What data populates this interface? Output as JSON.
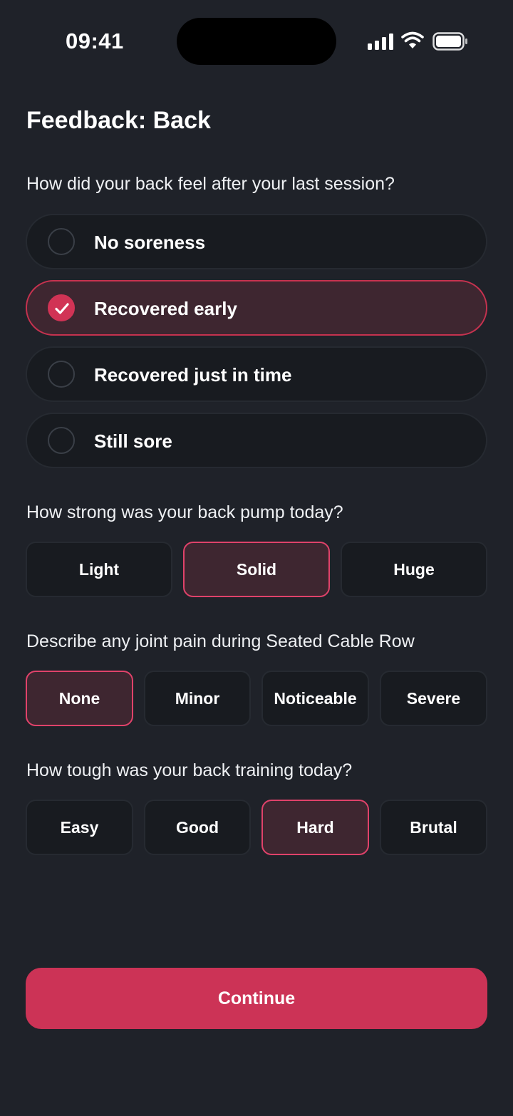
{
  "status_bar": {
    "time": "09:41"
  },
  "title": "Feedback: Back",
  "soreness": {
    "question": "How did your back feel after your last session?",
    "options": [
      {
        "label": "No soreness",
        "selected": false
      },
      {
        "label": "Recovered early",
        "selected": true
      },
      {
        "label": "Recovered just in time",
        "selected": false
      },
      {
        "label": "Still sore",
        "selected": false
      }
    ]
  },
  "pump": {
    "question": "How strong was your back pump today?",
    "options": [
      {
        "label": "Light",
        "selected": false
      },
      {
        "label": "Solid",
        "selected": true
      },
      {
        "label": "Huge",
        "selected": false
      }
    ]
  },
  "joint_pain": {
    "question": "Describe any joint pain during Seated Cable Row",
    "options": [
      {
        "label": "None",
        "selected": true
      },
      {
        "label": "Minor",
        "selected": false
      },
      {
        "label": "Noticeable",
        "selected": false
      },
      {
        "label": "Severe",
        "selected": false
      }
    ]
  },
  "difficulty": {
    "question": "How tough was your back training today?",
    "options": [
      {
        "label": "Easy",
        "selected": false
      },
      {
        "label": "Good",
        "selected": false
      },
      {
        "label": "Hard",
        "selected": true
      },
      {
        "label": "Brutal",
        "selected": false
      }
    ]
  },
  "continue_label": "Continue",
  "colors": {
    "accent": "#cc3356",
    "background": "#1f2229",
    "selected_fill": "#3e2630"
  }
}
